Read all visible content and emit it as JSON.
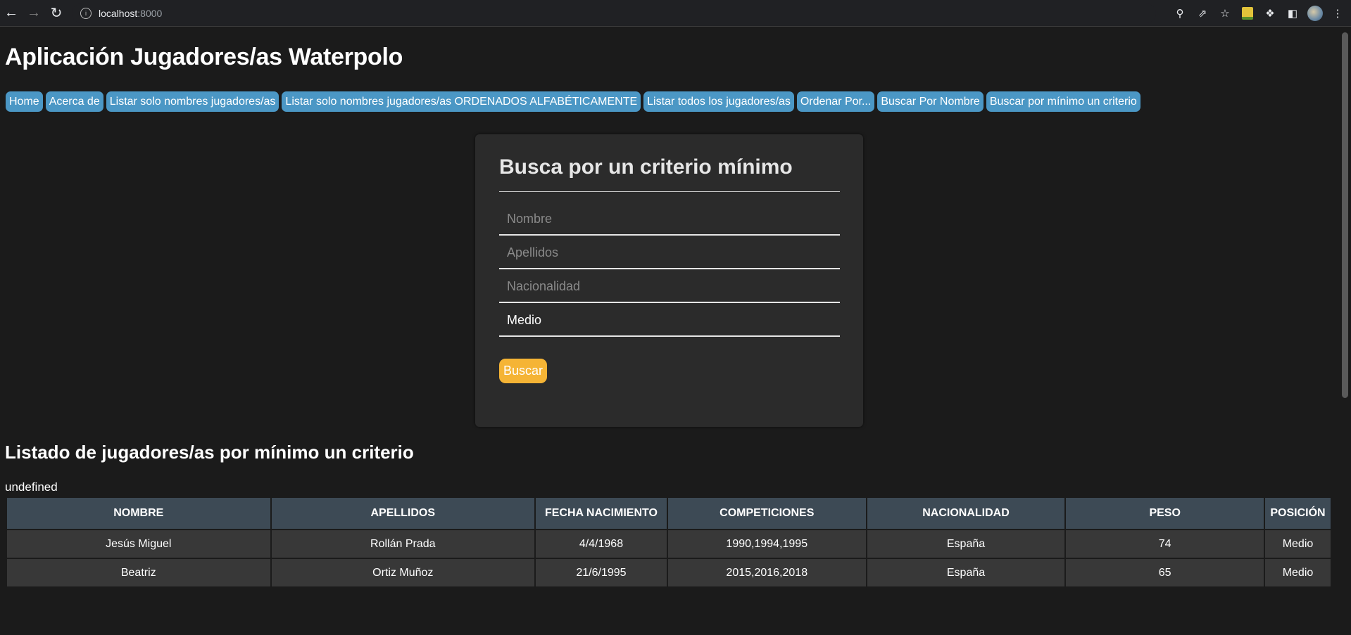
{
  "browser": {
    "host": "localhost",
    "port": ":8000",
    "icons": [
      "back-icon",
      "forward-icon",
      "reload-icon",
      "info-icon",
      "zoom-icon",
      "share-icon",
      "star-icon",
      "extension-icon",
      "puzzle-icon",
      "sidepanel-icon",
      "avatar",
      "menu-icon"
    ]
  },
  "page": {
    "title": "Aplicación Jugadores/as Waterpolo"
  },
  "nav": {
    "items": [
      "Home",
      "Acerca de",
      "Listar solo nombres jugadores/as",
      "Listar solo nombres jugadores/as ORDENADOS ALFABÉTICAMENTE",
      "Listar todos los jugadores/as",
      "Ordenar Por...",
      "Buscar Por Nombre",
      "Buscar por mínimo un criterio"
    ]
  },
  "form": {
    "title": "Busca por un criterio mínimo",
    "nombre": {
      "placeholder": "Nombre",
      "value": ""
    },
    "apellidos": {
      "placeholder": "Apellidos",
      "value": ""
    },
    "nacionalidad": {
      "placeholder": "Nacionalidad",
      "value": ""
    },
    "posicion": {
      "placeholder": "",
      "value": "Medio"
    },
    "submit_label": "Buscar"
  },
  "results": {
    "title": "Listado de jugadores/as por mínimo un criterio",
    "status": "undefined",
    "columns": [
      "NOMBRE",
      "APELLIDOS",
      "FECHA NACIMIENTO",
      "COMPETICIONES",
      "NACIONALIDAD",
      "PESO",
      "POSICIÓN"
    ],
    "rows": [
      [
        "Jesús Miguel",
        "Rollán Prada",
        "4/4/1968",
        "1990,1994,1995",
        "España",
        "74",
        "Medio"
      ],
      [
        "Beatriz",
        "Ortiz Muñoz",
        "21/6/1995",
        "2015,2016,2018",
        "España",
        "65",
        "Medio"
      ]
    ]
  }
}
